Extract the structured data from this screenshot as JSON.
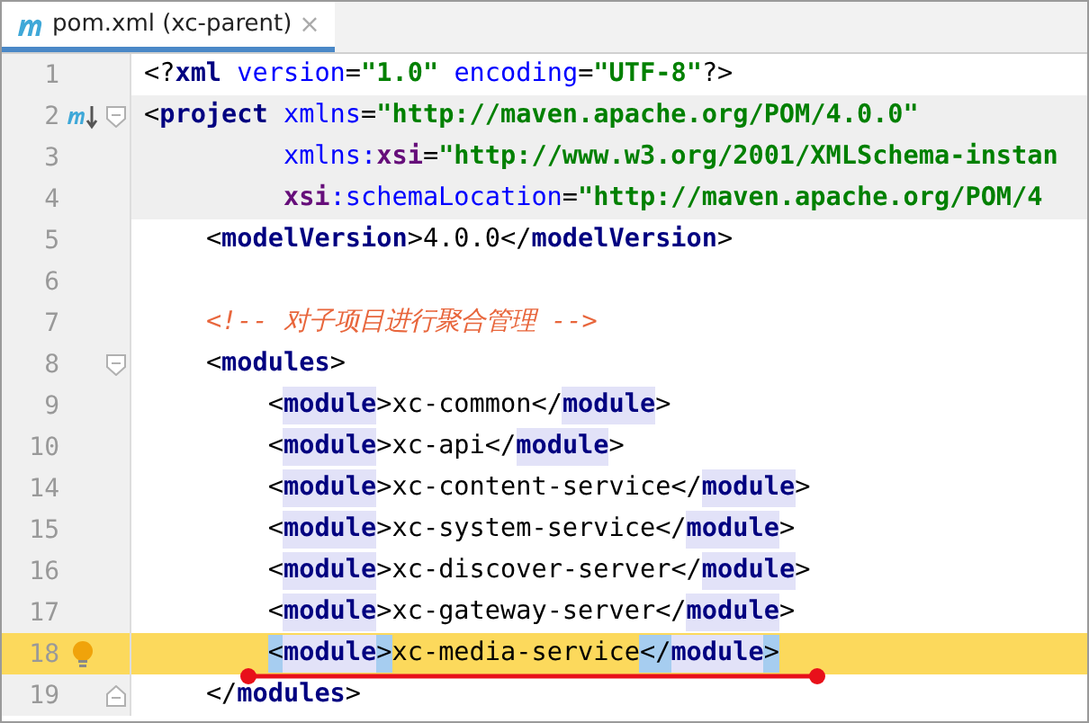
{
  "tab": {
    "label": "pom.xml (xc-parent)",
    "close": "×",
    "selected": true
  },
  "lines": [
    {
      "number": "1",
      "current": false,
      "underlined": false,
      "shaded": false,
      "text": "<?xml version=\"1.0\" encoding=\"UTF-8\"?>"
    },
    {
      "number": "2",
      "current": false,
      "underlined": false,
      "shaded": true,
      "gutter_icon": {
        "kind": "maven"
      },
      "fold_marker": {
        "kind": "start"
      },
      "text": "<project xmlns=\"http://maven.apache.org/POM/4.0.0\""
    },
    {
      "number": "3",
      "current": false,
      "underlined": false,
      "shaded": true,
      "text": "         xmlns:xsi=\"http://www.w3.org/2001/XMLSchema-instan"
    },
    {
      "number": "4",
      "current": false,
      "underlined": false,
      "shaded": true,
      "text": "         xsi:schemaLocation=\"http://maven.apache.org/POM/4"
    },
    {
      "number": "5",
      "current": false,
      "underlined": false,
      "shaded": false,
      "text": "    <modelVersion>4.0.0</modelVersion>"
    },
    {
      "number": "6",
      "current": false,
      "underlined": false,
      "shaded": false
    },
    {
      "number": "7",
      "current": false,
      "underlined": false,
      "shaded": false,
      "text": "    <!-- 对子项目进行聚合管理 -->"
    },
    {
      "number": "8",
      "current": false,
      "underlined": false,
      "shaded": false,
      "fold_marker": {
        "kind": "start"
      },
      "text": "    <modules>"
    },
    {
      "number": "9",
      "current": false,
      "underlined": false,
      "shaded": false,
      "text": "        <module>xc-common</module>"
    },
    {
      "number": "10",
      "current": false,
      "underlined": false,
      "shaded": false,
      "text": "        <module>xc-api</module>"
    },
    {
      "number": "14",
      "current": false,
      "underlined": false,
      "shaded": false,
      "text": "        <module>xc-content-service</module>"
    },
    {
      "number": "15",
      "current": false,
      "underlined": false,
      "shaded": false,
      "text": "        <module>xc-system-service</module>"
    },
    {
      "number": "16",
      "current": false,
      "underlined": false,
      "shaded": false,
      "text": "        <module>xc-discover-server</module>"
    },
    {
      "number": "17",
      "current": false,
      "underlined": false,
      "shaded": false,
      "text": "        <module>xc-gateway-server</module>"
    },
    {
      "number": "18",
      "current": true,
      "underlined": true,
      "shaded": false,
      "gutter_icon": {
        "kind": "bulb"
      },
      "text": "        <module>xc-media-service</module>"
    },
    {
      "number": "19",
      "current": false,
      "underlined": false,
      "shaded": false,
      "fold_marker": {
        "kind": "end"
      },
      "text": "    </modules>"
    }
  ]
}
